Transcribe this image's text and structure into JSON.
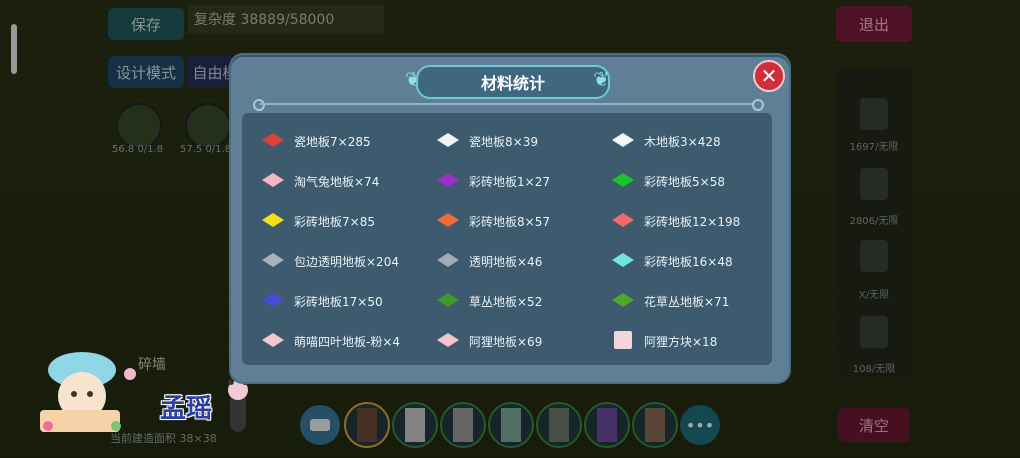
{
  "background": {
    "save_label": "保存",
    "design_mode_label": "设计模式",
    "free_label": "自由模",
    "exit_label": "退出",
    "clear_label": "清空",
    "complexity_text": "复杂度 38889/58000",
    "thumb1_label": "56.8 0/1.8",
    "thumb2_label": "57.5 0/1.8",
    "icon_label": "碎墙",
    "bottom_label": "当前建造面积 38×38",
    "right_panel": [
      {
        "label": "1697/无限"
      },
      {
        "label": "2806/无限"
      },
      {
        "label": "X/无限"
      },
      {
        "label": "108/无限"
      }
    ],
    "more_label": "•••"
  },
  "watermark": {
    "name": "孟瑶"
  },
  "modal": {
    "title": "材料统计",
    "close_label": "✕",
    "materials": [
      {
        "label": "瓷地板7×285",
        "color": "#d8443c"
      },
      {
        "label": "瓷地板8×39",
        "color": "#f4f2ee"
      },
      {
        "label": "木地板3×428",
        "color": "#f6f6f4"
      },
      {
        "label": "淘气兔地板×74",
        "color": "#f3b6bf"
      },
      {
        "label": "彩砖地板1×27",
        "color": "#9a2fc4"
      },
      {
        "label": "彩砖地板5×58",
        "color": "#1dc52c"
      },
      {
        "label": "彩砖地板7×85",
        "color": "#f4e01a"
      },
      {
        "label": "彩砖地板8×57",
        "color": "#f06a3a"
      },
      {
        "label": "彩砖地板12×198",
        "color": "#f06a6a"
      },
      {
        "label": "包边透明地板×204",
        "color": "#a6b1ba"
      },
      {
        "label": "透明地板×46",
        "color": "#9eadb8"
      },
      {
        "label": "彩砖地板16×48",
        "color": "#6fe6e0"
      },
      {
        "label": "彩砖地板17×50",
        "color": "#4a4ad4"
      },
      {
        "label": "草丛地板×52",
        "color": "#3f9a2a"
      },
      {
        "label": "花草丛地板×71",
        "color": "#4ea82a"
      },
      {
        "label": "萌喵四叶地板-粉×4",
        "color": "#f1c8cc"
      },
      {
        "label": "阿狸地板×69",
        "color": "#f4c4c8"
      },
      {
        "label": "阿狸方块×18",
        "color": "#f7d6d9"
      }
    ]
  }
}
